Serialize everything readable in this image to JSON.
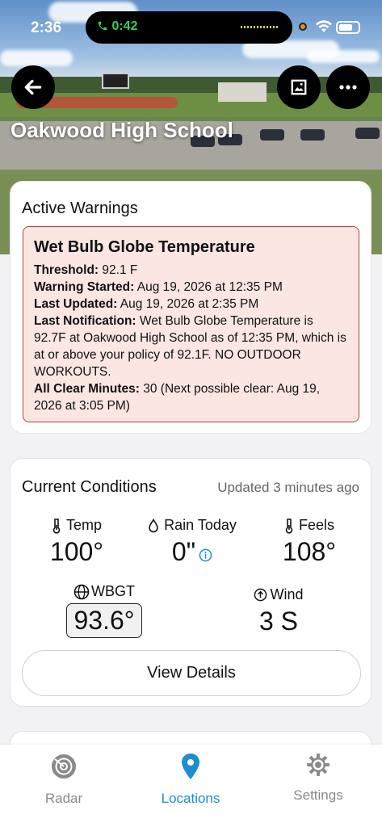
{
  "status_bar": {
    "time": "2:36",
    "call_timer": "0:42"
  },
  "header": {
    "school_name": "Oakwood High School",
    "back_icon": "arrow-left-icon",
    "image_icon": "image-icon",
    "more_icon": "ellipsis-icon"
  },
  "warnings": {
    "heading": "Active Warnings",
    "title": "Wet Bulb Globe Temperature",
    "threshold_label": "Threshold:",
    "threshold_value": "92.1 F",
    "started_label": "Warning Started:",
    "started_value": "Aug 19, 2026 at 12:35 PM",
    "updated_label": "Last Updated:",
    "updated_value": "Aug 19, 2026 at 2:35 PM",
    "notification_label": "Last Notification:",
    "notification_value": "Wet Bulb Globe Temperature is 92.7F at Oakwood High School  as of 12:35 PM, which is at or above your policy of 92.1F. NO OUTDOOR WORKOUTS.",
    "allclear_label": "All Clear Minutes:",
    "allclear_value": "30 (Next possible clear: Aug 19, 2026 at 3:05 PM)",
    "colors": {
      "background": "#fbe6e1",
      "border": "#b2443b"
    }
  },
  "conditions": {
    "title": "Current Conditions",
    "updated": "Updated 3 minutes ago",
    "temp": {
      "label": "Temp",
      "value": "100°",
      "icon": "thermometer-icon"
    },
    "rain": {
      "label": "Rain Today",
      "value": "0\"",
      "icon": "raindrop-icon"
    },
    "feels": {
      "label": "Feels",
      "value": "108°",
      "icon": "thermometer-icon"
    },
    "wbgt": {
      "label": "WBGT",
      "value": "93.6°",
      "icon": "globe-icon"
    },
    "wind": {
      "label": "Wind",
      "value": "3 S",
      "icon": "arrow-up-circle-icon"
    },
    "details_button": "View Details"
  },
  "tabs": [
    {
      "label": "Radar",
      "icon": "radar-icon",
      "active": false
    },
    {
      "label": "Locations",
      "icon": "location-pin-icon",
      "active": true
    },
    {
      "label": "Settings",
      "icon": "gear-icon",
      "active": false
    }
  ],
  "accent_color": "#1e8fce"
}
